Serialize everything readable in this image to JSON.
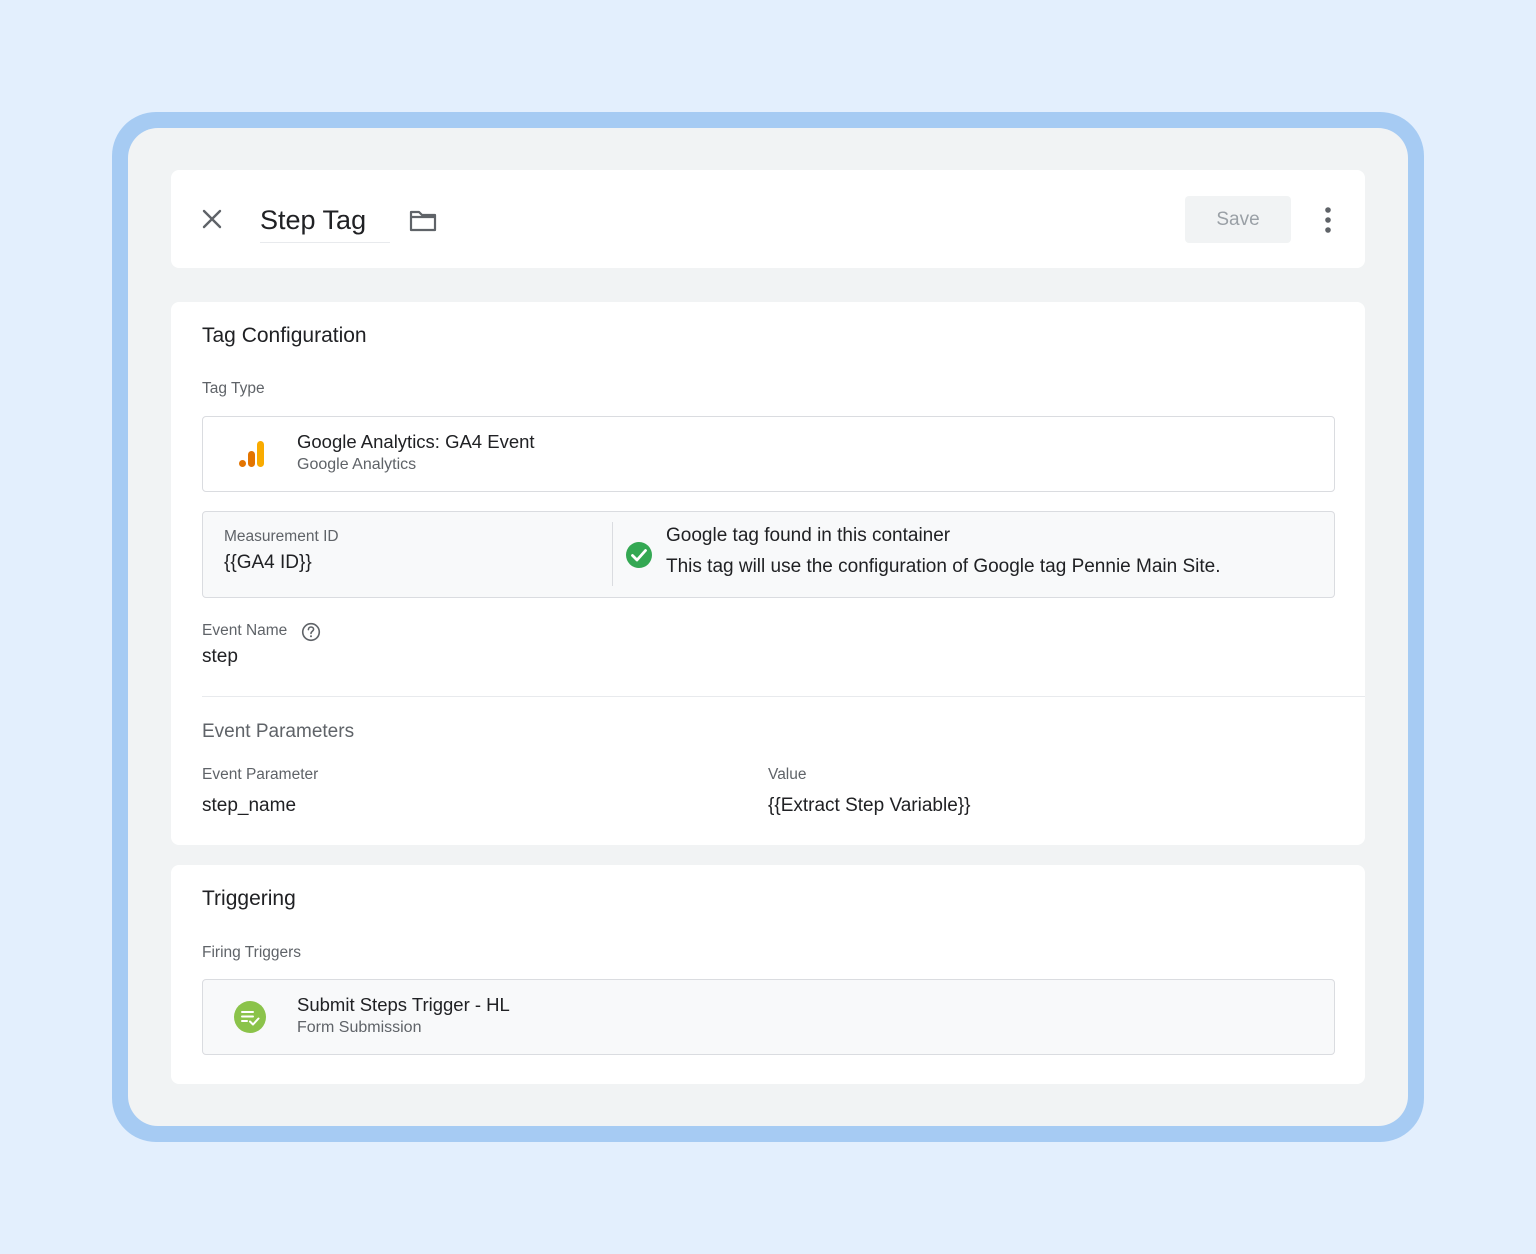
{
  "header": {
    "title": "Step Tag",
    "save_label": "Save"
  },
  "config": {
    "section_title": "Tag Configuration",
    "tag_type_label": "Tag Type",
    "tag_type_name": "Google Analytics: GA4 Event",
    "tag_type_sub": "Google Analytics",
    "measurement_id_label": "Measurement ID",
    "measurement_id_value": "{{GA4 ID}}",
    "google_tag_found_title": "Google tag found in this container",
    "google_tag_found_desc": "This tag will use the configuration of Google tag Pennie Main Site.",
    "event_name_label": "Event Name",
    "event_name_value": "step",
    "event_params_heading": "Event Parameters",
    "param_col_label": "Event Parameter",
    "value_col_label": "Value",
    "params": [
      {
        "name": "step_name",
        "value": "{{Extract Step Variable}}"
      }
    ]
  },
  "triggering": {
    "section_title": "Triggering",
    "firing_label": "Firing Triggers",
    "trigger_name": "Submit Steps Trigger - HL",
    "trigger_type": "Form Submission"
  },
  "colors": {
    "page_bg": "#e3effd",
    "frame": "#a6cbf3",
    "analytics_orange": "#f9ab00",
    "analytics_dark_orange": "#e37400",
    "check_green": "#34a853",
    "trigger_green": "#8bc34a"
  },
  "icons": {
    "close": "close-icon",
    "folder": "folder-icon",
    "more": "more-vert-icon",
    "analytics": "google-analytics-icon",
    "check": "check-circle-icon",
    "help": "help-icon",
    "trigger": "form-submission-icon"
  }
}
